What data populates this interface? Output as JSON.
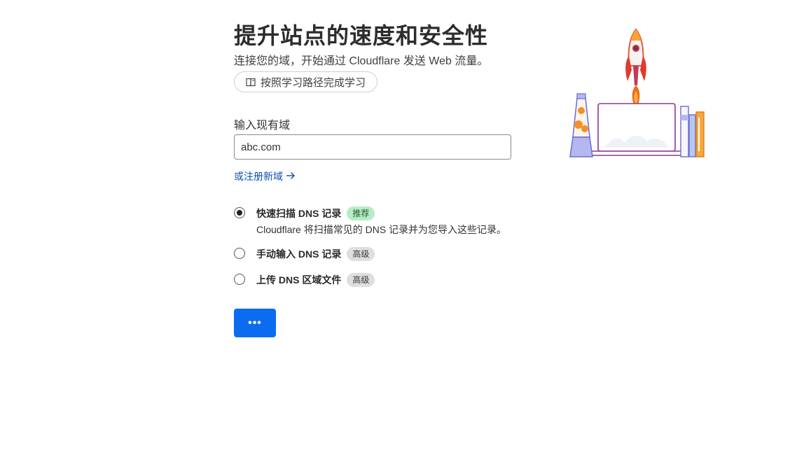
{
  "header": {
    "title": "提升站点的速度和安全性",
    "subtitle": "连接您的域，开始通过 Cloudflare 发送 Web 流量。",
    "learn_button": "按照学习路径完成学习"
  },
  "form": {
    "domain_label": "输入现有域",
    "domain_value": "abc.com",
    "register_link": "或注册新域"
  },
  "dns_options": [
    {
      "title": "快速扫描 DNS 记录",
      "badge": "推荐",
      "description": "Cloudflare 将扫描常见的 DNS 记录并为您导入这些记录。",
      "selected": true
    },
    {
      "title": "手动输入 DNS 记录",
      "badge": "高级",
      "selected": false
    },
    {
      "title": "上传 DNS 区域文件",
      "badge": "高级",
      "selected": false
    }
  ],
  "continue_button": "•••",
  "icons": {
    "learn": "book-icon",
    "arrow": "arrow-right-icon",
    "illustration": "rocket-laptop-illustration"
  },
  "colors": {
    "primary": "#0b6cf2",
    "link": "#0a4fb3",
    "badge_recommended": "#b7ecc6",
    "badge_advanced": "#dedede"
  }
}
